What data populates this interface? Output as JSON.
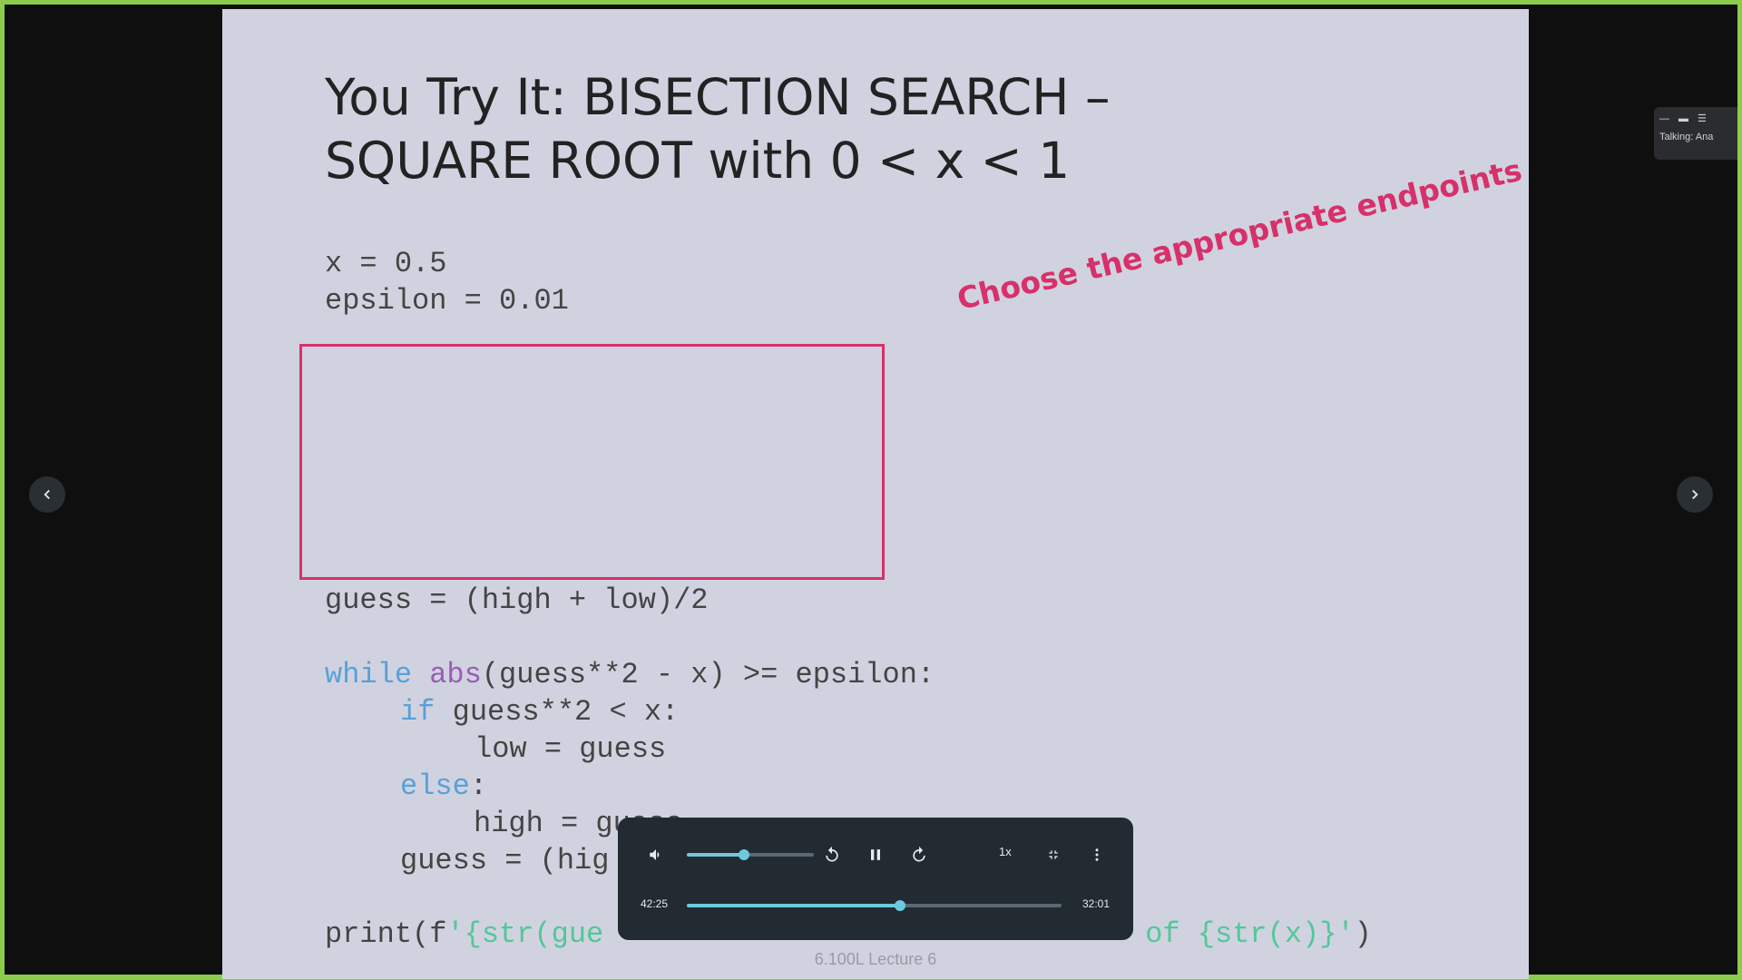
{
  "slide": {
    "title_line1": "You Try It: BISECTION SEARCH –",
    "title_line2": "SQUARE ROOT with 0 < x < 1",
    "code_x": "x = 0.5",
    "code_epsilon": "epsilon = 0.01",
    "annotation": "Choose the appropriate endpoints",
    "code_guess": "guess = (high + low)/2",
    "code_while_kw": "while",
    "code_while_abs": "abs",
    "code_while_rest": "(guess**2 - x) >= epsilon:",
    "code_if_kw": "if",
    "code_if_rest": " guess**2 < x:",
    "code_low": "low = guess",
    "code_else_kw": "else",
    "code_else_colon": ":",
    "code_high": "high = guess",
    "code_guess2": "guess = (hig",
    "code_print_start": "print(f",
    "code_print_str": "'{str(gue",
    "code_print_end_str": " of {str(x)}'",
    "code_print_close": ")",
    "footer": "6.100L Lecture 6"
  },
  "navigation": {
    "prev_icon": "chevron-left-icon",
    "next_icon": "chevron-right-icon"
  },
  "mini_toolbar": {
    "label": "Talking: Ana"
  },
  "player": {
    "current_time": "42:25",
    "total_time": "32:01",
    "speed": "1x",
    "volume_fraction": 0.45,
    "progress_fraction": 0.57,
    "accent_color": "#6ec9e0"
  },
  "colors": {
    "border": "#8ccc4c",
    "slide_bg": "#d0d3df",
    "annotation": "#d8306a"
  }
}
